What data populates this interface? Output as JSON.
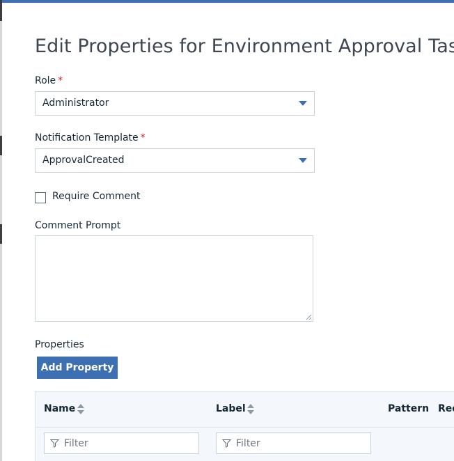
{
  "dialog": {
    "title": "Edit Properties for Environment Approval Task"
  },
  "form": {
    "role": {
      "label": "Role",
      "required_mark": "*",
      "value": "Administrator"
    },
    "notification_template": {
      "label": "Notification Template",
      "required_mark": "*",
      "value": "ApprovalCreated"
    },
    "require_comment": {
      "label": "Require Comment",
      "checked": false
    },
    "comment_prompt": {
      "label": "Comment Prompt",
      "value": ""
    }
  },
  "properties": {
    "label": "Properties",
    "add_button_label": "Add Property",
    "table": {
      "columns": [
        {
          "label": "Name",
          "sortable": true
        },
        {
          "label": "Label",
          "sortable": true
        },
        {
          "label": "Pattern",
          "sortable": false
        },
        {
          "label": "Req",
          "sortable": false
        }
      ],
      "filter_placeholder": "Filter"
    }
  },
  "colors": {
    "accent": "#3d70b2",
    "required": "#e0182d",
    "table_header_bg": "#f4f7fb"
  }
}
